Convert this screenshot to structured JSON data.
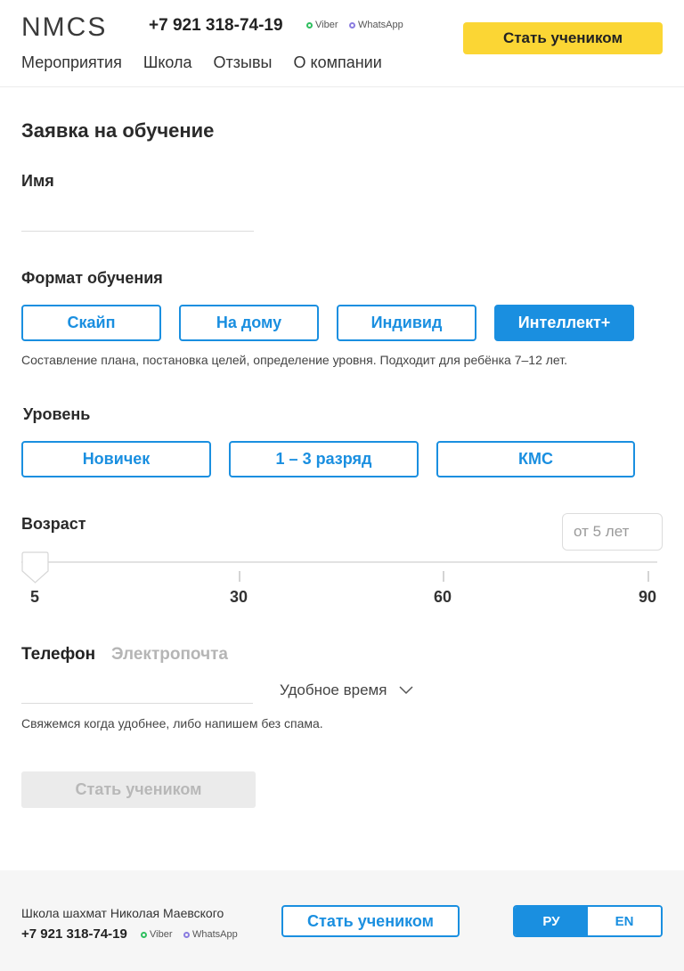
{
  "header": {
    "logo": "NMCS",
    "phone": "+7 921 318-74-19",
    "messengers": [
      {
        "name": "Viber",
        "color": "#2fbf5f"
      },
      {
        "name": "WhatsApp",
        "color": "#8a7ce0"
      }
    ],
    "cta_label": "Стать учеником",
    "nav": [
      "Мероприятия",
      "Школа",
      "Отзывы",
      "О компании"
    ]
  },
  "form": {
    "title": "Заявка на обучение",
    "name_label": "Имя",
    "name_value": "",
    "format_label": "Формат обучения",
    "formats": [
      {
        "label": "Скайп",
        "selected": false
      },
      {
        "label": "На дому",
        "selected": false
      },
      {
        "label": "Индивид",
        "selected": false
      },
      {
        "label": "Интеллект+",
        "selected": true
      }
    ],
    "format_hint": "Составление плана, постановка целей, определение уровня. Подходит для ребёнка 7–12 лет.",
    "level_label": "Уровень",
    "levels": [
      {
        "label": "Новичек",
        "selected": false
      },
      {
        "label": "1 – 3 разряд",
        "selected": false
      },
      {
        "label": "КМС",
        "selected": false
      }
    ],
    "age_label": "Возраст",
    "age_placeholder": "от 5 лет",
    "age_slider": {
      "min": 5,
      "max": 90,
      "value": 5,
      "ticks": [
        "5",
        "30",
        "60",
        "90"
      ]
    },
    "contact_tabs": [
      {
        "label": "Телефон",
        "active": true
      },
      {
        "label": "Электропочта",
        "active": false
      }
    ],
    "contact_value": "",
    "time_select": "Удобное время",
    "contact_hint": "Свяжемся  когда удобнее, либо напишем без спама.",
    "submit_label": "Стать учеником",
    "submit_disabled": true
  },
  "footer": {
    "school": "Школа шахмат Николая Маевского",
    "phone": "+7 921 318-74-19",
    "messengers": [
      "Viber",
      "WhatsApp"
    ],
    "cta_label": "Стать учеником",
    "languages": [
      {
        "code": "РУ",
        "active": true
      },
      {
        "code": "EN",
        "active": false
      }
    ]
  },
  "colors": {
    "accent": "#1a8fe0",
    "cta_yellow": "#fbd634",
    "viber": "#2fbf5f",
    "whatsapp": "#8a7ce0"
  }
}
